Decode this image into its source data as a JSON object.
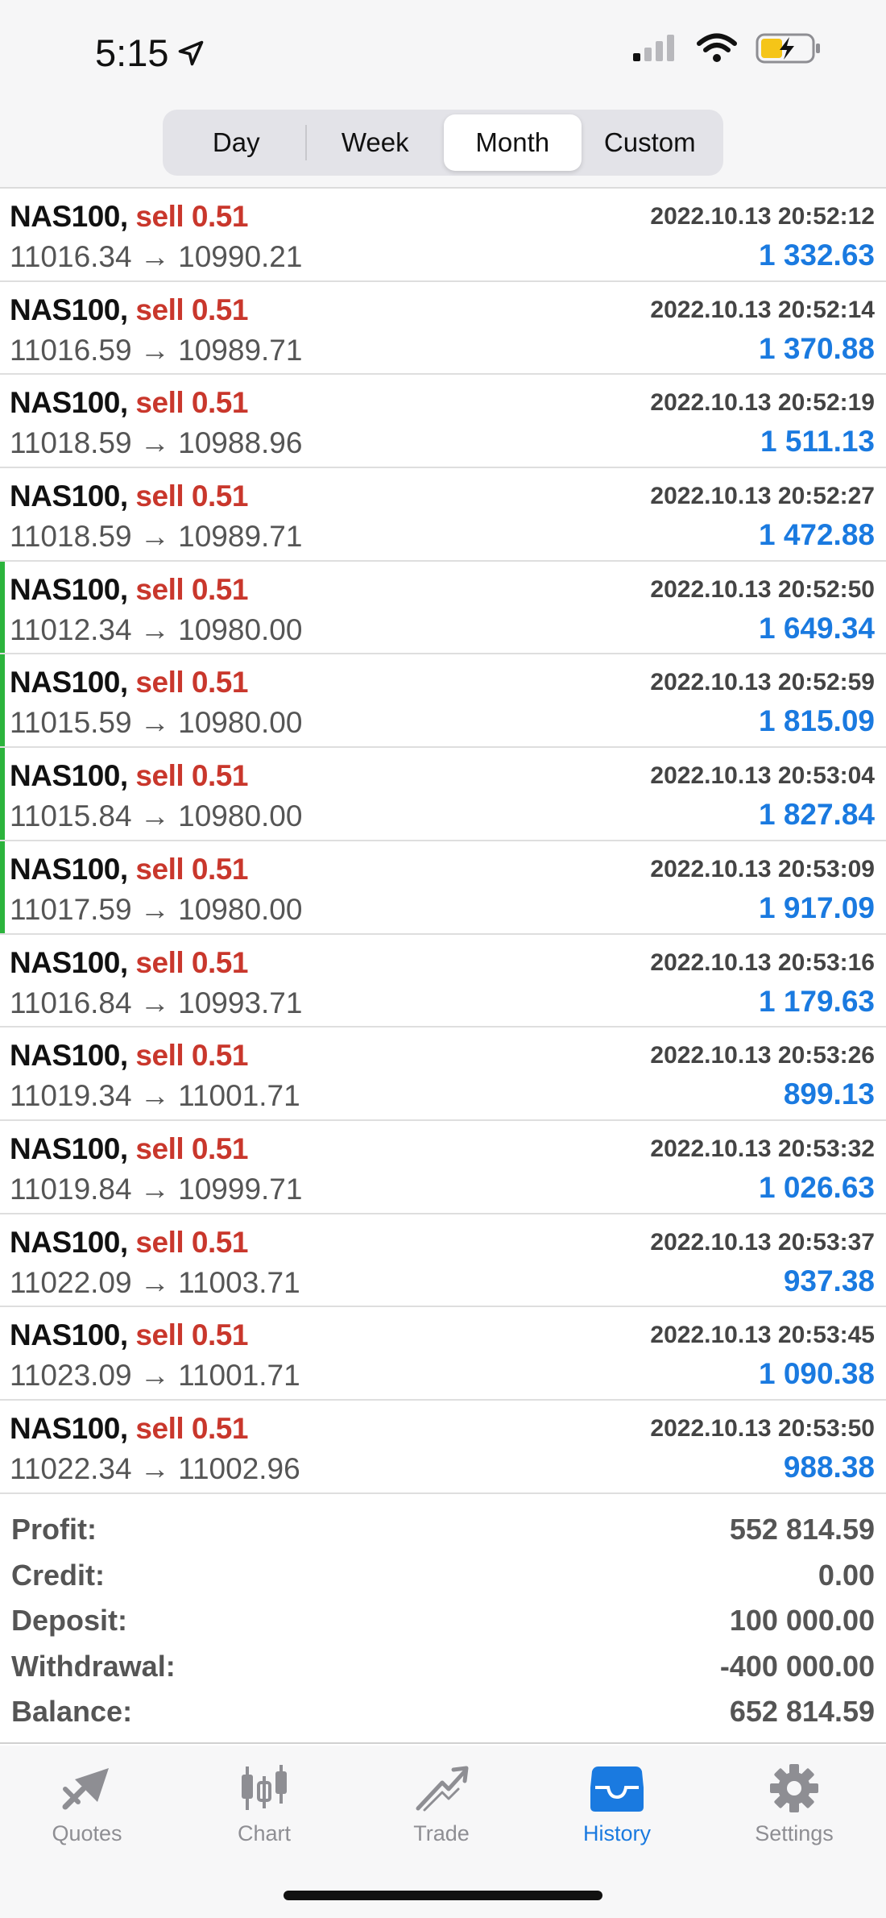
{
  "status_bar": {
    "time": "5:15"
  },
  "segments": [
    {
      "label": "Day",
      "active": false
    },
    {
      "label": "Week",
      "active": false
    },
    {
      "label": "Month",
      "active": true
    },
    {
      "label": "Custom",
      "active": false
    }
  ],
  "trades": [
    {
      "symbol": "NAS100,",
      "side": "sell 0.51",
      "prices": "11016.34 → 10990.21",
      "time": "2022.10.13 20:52:12",
      "profit": "1 332.63",
      "marked": false
    },
    {
      "symbol": "NAS100,",
      "side": "sell 0.51",
      "prices": "11016.59 → 10989.71",
      "time": "2022.10.13 20:52:14",
      "profit": "1 370.88",
      "marked": false
    },
    {
      "symbol": "NAS100,",
      "side": "sell 0.51",
      "prices": "11018.59 → 10988.96",
      "time": "2022.10.13 20:52:19",
      "profit": "1 511.13",
      "marked": false
    },
    {
      "symbol": "NAS100,",
      "side": "sell 0.51",
      "prices": "11018.59 → 10989.71",
      "time": "2022.10.13 20:52:27",
      "profit": "1 472.88",
      "marked": false
    },
    {
      "symbol": "NAS100,",
      "side": "sell 0.51",
      "prices": "11012.34 → 10980.00",
      "time": "2022.10.13 20:52:50",
      "profit": "1 649.34",
      "marked": true
    },
    {
      "symbol": "NAS100,",
      "side": "sell 0.51",
      "prices": "11015.59 → 10980.00",
      "time": "2022.10.13 20:52:59",
      "profit": "1 815.09",
      "marked": true
    },
    {
      "symbol": "NAS100,",
      "side": "sell 0.51",
      "prices": "11015.84 → 10980.00",
      "time": "2022.10.13 20:53:04",
      "profit": "1 827.84",
      "marked": true
    },
    {
      "symbol": "NAS100,",
      "side": "sell 0.51",
      "prices": "11017.59 → 10980.00",
      "time": "2022.10.13 20:53:09",
      "profit": "1 917.09",
      "marked": true
    },
    {
      "symbol": "NAS100,",
      "side": "sell 0.51",
      "prices": "11016.84 → 10993.71",
      "time": "2022.10.13 20:53:16",
      "profit": "1 179.63",
      "marked": false
    },
    {
      "symbol": "NAS100,",
      "side": "sell 0.51",
      "prices": "11019.34 → 11001.71",
      "time": "2022.10.13 20:53:26",
      "profit": "899.13",
      "marked": false
    },
    {
      "symbol": "NAS100,",
      "side": "sell 0.51",
      "prices": "11019.84 → 10999.71",
      "time": "2022.10.13 20:53:32",
      "profit": "1 026.63",
      "marked": false
    },
    {
      "symbol": "NAS100,",
      "side": "sell 0.51",
      "prices": "11022.09 → 11003.71",
      "time": "2022.10.13 20:53:37",
      "profit": "937.38",
      "marked": false
    },
    {
      "symbol": "NAS100,",
      "side": "sell 0.51",
      "prices": "11023.09 → 11001.71",
      "time": "2022.10.13 20:53:45",
      "profit": "1 090.38",
      "marked": false
    },
    {
      "symbol": "NAS100,",
      "side": "sell 0.51",
      "prices": "11022.34 → 11002.96",
      "time": "2022.10.13 20:53:50",
      "profit": "988.38",
      "marked": false
    }
  ],
  "summary": [
    {
      "label": "Profit:",
      "value": "552 814.59"
    },
    {
      "label": "Credit:",
      "value": "0.00"
    },
    {
      "label": "Deposit:",
      "value": "100 000.00"
    },
    {
      "label": "Withdrawal:",
      "value": "-400 000.00"
    },
    {
      "label": "Balance:",
      "value": "652 814.59"
    }
  ],
  "tabs": [
    {
      "label": "Quotes",
      "icon": "quotes-icon",
      "active": false
    },
    {
      "label": "Chart",
      "icon": "chart-icon",
      "active": false
    },
    {
      "label": "Trade",
      "icon": "trade-icon",
      "active": false
    },
    {
      "label": "History",
      "icon": "history-icon",
      "active": true
    },
    {
      "label": "Settings",
      "icon": "gear-icon",
      "active": false
    }
  ],
  "colors": {
    "sell": "#c9372c",
    "profit": "#1a7ae0",
    "active_tab": "#1a7ae0",
    "inactive_tab": "#8e8e93",
    "marker": "#2cb43c"
  }
}
